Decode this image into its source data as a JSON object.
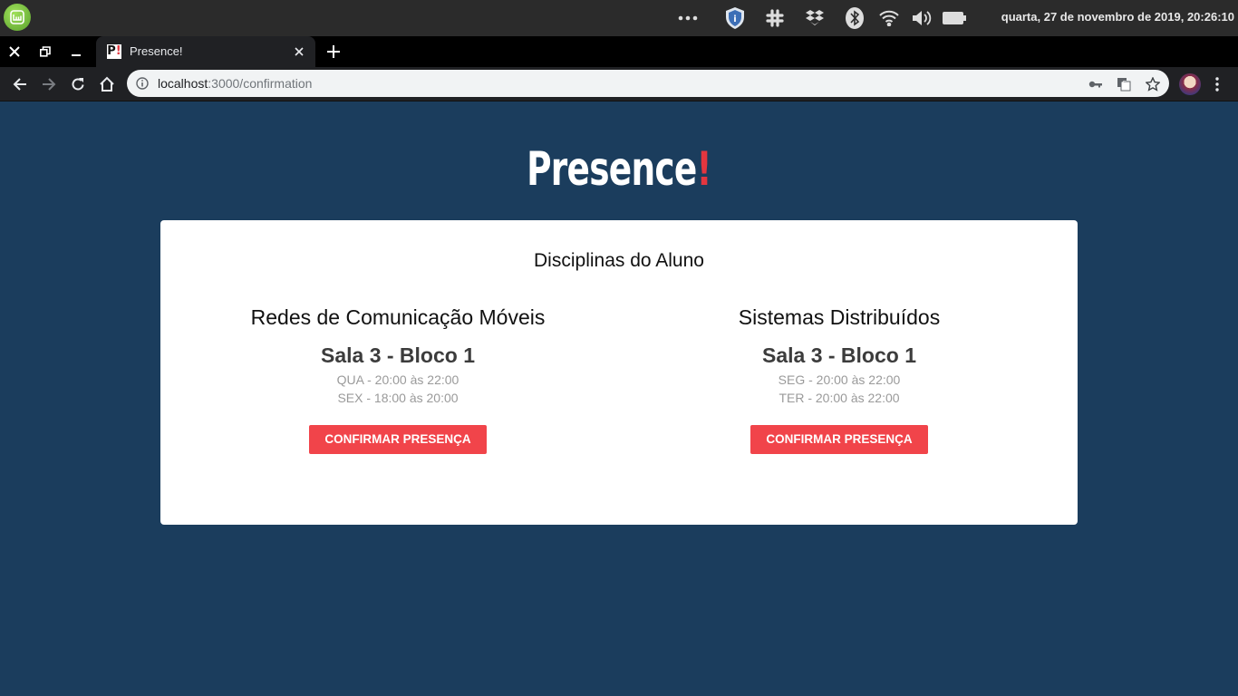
{
  "system_bar": {
    "clock": "quarta, 27 de novembro de 2019, 20:26:10"
  },
  "browser": {
    "tab": {
      "title": "Presence!",
      "favicon_text": "P",
      "favicon_mark": "!"
    },
    "url": {
      "host": "localhost",
      "path": ":3000/confirmation"
    }
  },
  "brand": {
    "name": "Presence",
    "mark": "!"
  },
  "card": {
    "title": "Disciplinas do Aluno",
    "courses": [
      {
        "name": "Redes de Comunicação Móveis",
        "room": "Sala 3 - Bloco 1",
        "times": [
          "QUA - 20:00 às 22:00",
          "SEX - 18:00 às 20:00"
        ],
        "button": "Confirmar presença"
      },
      {
        "name": "Sistemas Distribuídos",
        "room": "Sala 3 - Bloco 1",
        "times": [
          "SEG - 20:00 às 22:00",
          "TER - 20:00 às 22:00"
        ],
        "button": "Confirmar presença"
      }
    ]
  },
  "colors": {
    "page_background": "#1b3d5d",
    "accent": "#f1444a",
    "brand_mark": "#e4363f"
  },
  "icons": {
    "system_bar": [
      "mint-menu-icon",
      "more-dots-icon",
      "shield-icon",
      "slack-icon",
      "dropbox-icon",
      "bluetooth-icon",
      "wifi-icon",
      "volume-icon",
      "battery-icon"
    ],
    "toolbar": [
      "back-icon",
      "forward-icon",
      "reload-icon",
      "home-icon",
      "info-icon",
      "key-icon",
      "translate-icon",
      "star-icon",
      "menu-icon"
    ]
  }
}
